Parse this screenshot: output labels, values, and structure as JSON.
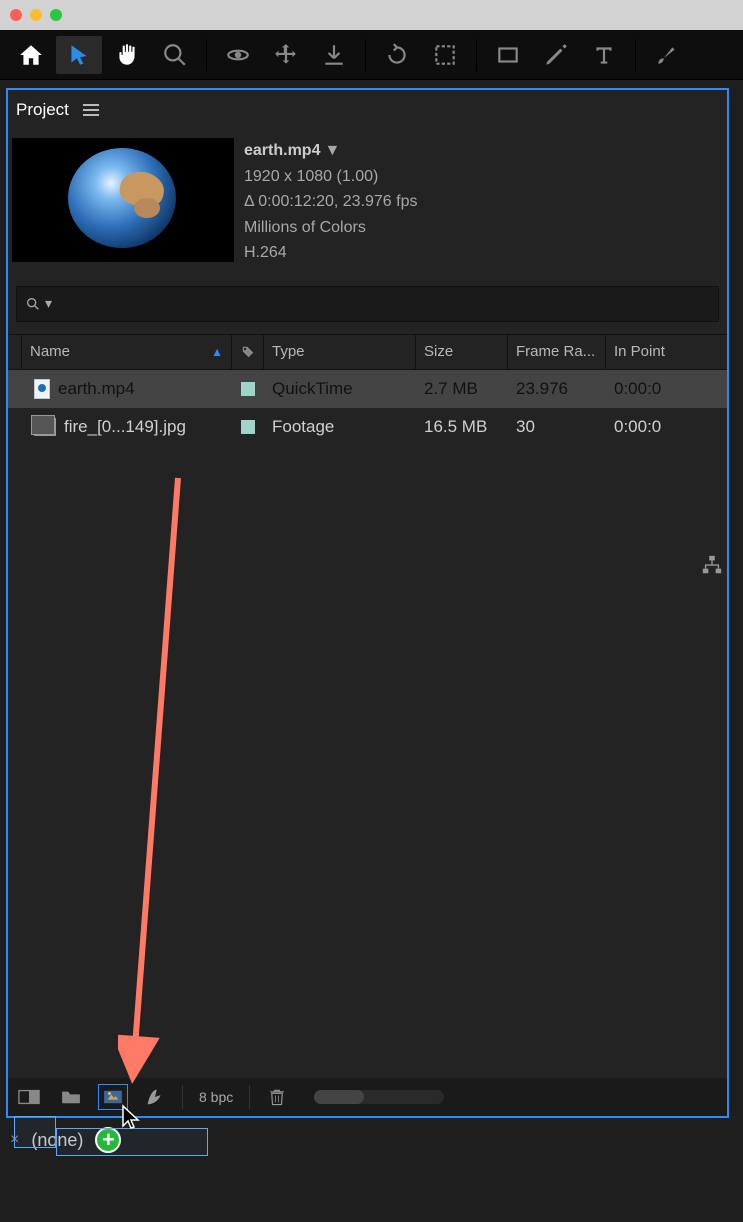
{
  "panel": {
    "title": "Project"
  },
  "preview": {
    "filename": "earth.mp4",
    "dimensions": "1920 x 1080 (1.00)",
    "duration": "Δ 0:00:12:20, 23.976 fps",
    "colors": "Millions of Colors",
    "codec": "H.264"
  },
  "search": {
    "placeholder": ""
  },
  "columns": {
    "name": "Name",
    "type": "Type",
    "size": "Size",
    "frame_rate": "Frame Ra...",
    "in_point": "In Point"
  },
  "rows": [
    {
      "name": "earth.mp4",
      "type": "QuickTime",
      "size": "2.7 MB",
      "frame_rate": "23.976",
      "in_point": "0:00:0",
      "selected": true,
      "icon": "file"
    },
    {
      "name": "fire_[0...149].jpg",
      "type": "Footage",
      "size": "16.5 MB",
      "frame_rate": "30",
      "in_point": "0:00:0",
      "selected": false,
      "icon": "seq"
    }
  ],
  "footer": {
    "bpc": "8 bpc"
  },
  "timeline": {
    "label": "(none)"
  }
}
